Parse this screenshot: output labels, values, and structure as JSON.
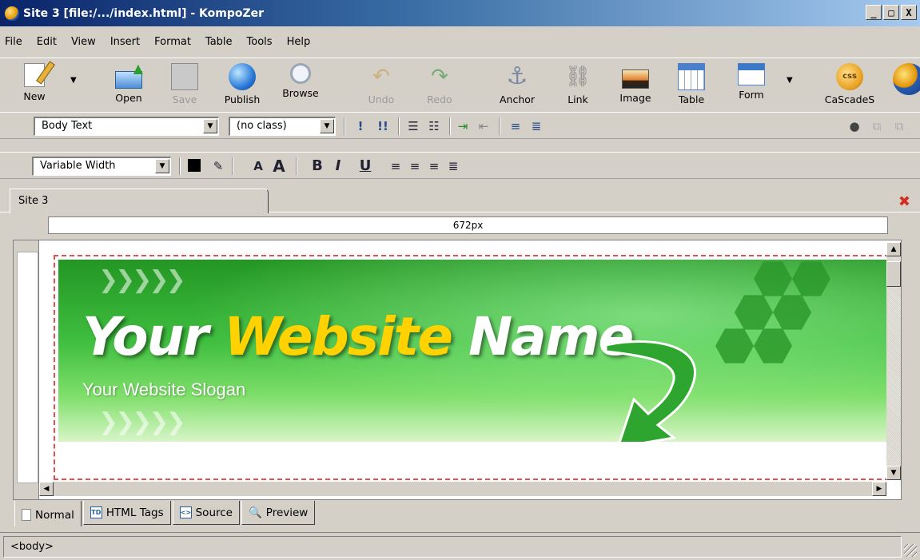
{
  "window": {
    "title": "Site 3 [file:/.../index.html] - KompoZer",
    "btn_minimize": "_",
    "btn_maximize": "□",
    "btn_close": "X"
  },
  "menubar": [
    "File",
    "Edit",
    "View",
    "Insert",
    "Format",
    "Table",
    "Tools",
    "Help"
  ],
  "toolbar": {
    "new": "New",
    "open": "Open",
    "save": "Save",
    "publish": "Publish",
    "browse": "Browse",
    "undo": "Undo",
    "redo": "Redo",
    "anchor": "Anchor",
    "link": "Link",
    "image": "Image",
    "table": "Table",
    "form": "Form",
    "cascades": "CaScadeS",
    "css_badge": "css"
  },
  "format_toolbar": {
    "paragraph_style": "Body Text",
    "class": "(no class)",
    "font": "Variable Width"
  },
  "document_tab": "Site 3",
  "ruler": "672px",
  "banner": {
    "name_part1": "Your",
    "name_part2": "Website",
    "name_part3": "Name",
    "slogan": "Your Website Slogan"
  },
  "view_tabs": {
    "normal": "Normal",
    "html_tags": "HTML Tags",
    "source": "Source",
    "preview": "Preview",
    "td_badge": "TD",
    "source_badge": "<>"
  },
  "status": "<body>"
}
